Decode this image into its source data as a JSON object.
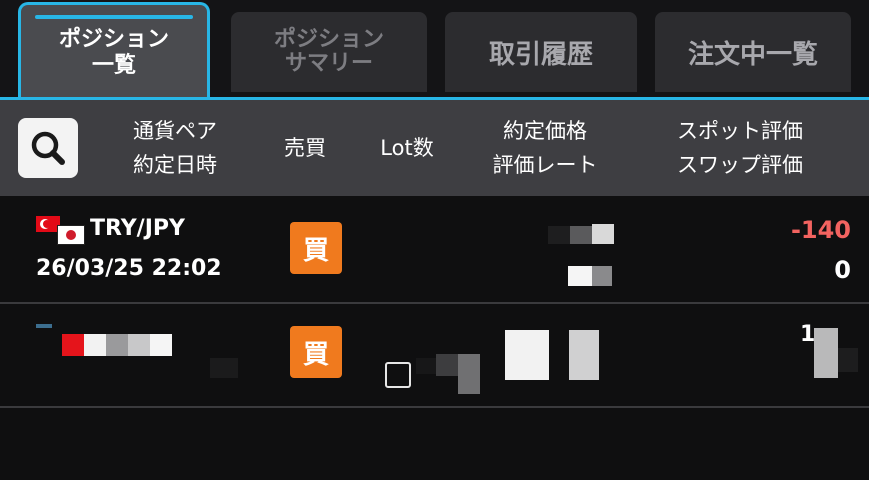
{
  "tabs": {
    "positions": {
      "line1": "ポジション",
      "line2": "一覧"
    },
    "summary": {
      "line1": "ポジション",
      "line2": "サマリー"
    },
    "history": {
      "label": "取引履歴"
    },
    "orders": {
      "label": "注文中一覧"
    }
  },
  "header": {
    "pair_line1": "通貨ペア",
    "pair_line2": "約定日時",
    "side": "売買",
    "lot": "Lot数",
    "price_line1": "約定価格",
    "price_line2": "評価レート",
    "eval_line1": "スポット評価",
    "eval_line2": "スワップ評価"
  },
  "positions": [
    {
      "pair": "TRY/JPY",
      "datetime": "26/03/25 22:02",
      "side": "買",
      "spot_eval": "-140",
      "swap_eval": "0"
    },
    {
      "side": "買",
      "partial_number": "1"
    }
  ],
  "colors": {
    "accent": "#28b6e6",
    "buy_badge": "#f07a1e",
    "negative": "#f26360"
  },
  "icons": {
    "search": "magnifier-icon"
  }
}
